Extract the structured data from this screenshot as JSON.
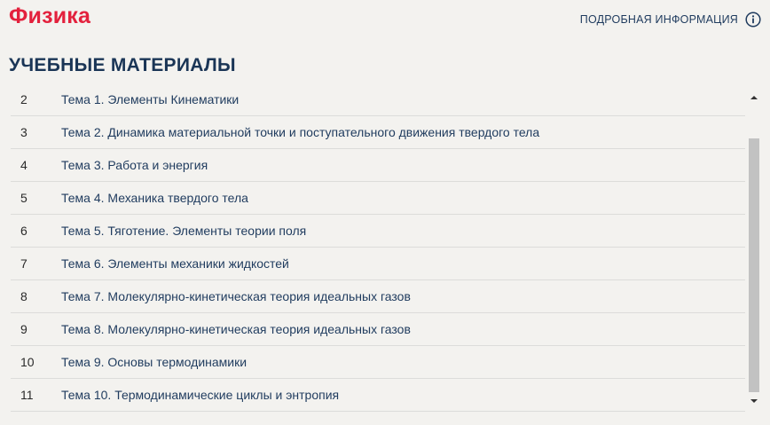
{
  "header": {
    "app_title": "Физика",
    "info_label": "ПОДРОБНАЯ ИНФОРМАЦИЯ",
    "info_icon": "info-circle-icon"
  },
  "section": {
    "title": "УЧЕБНЫЕ МАТЕРИАЛЫ"
  },
  "materials": [
    {
      "num": "2",
      "title": "Тема 1. Элементы Кинематики"
    },
    {
      "num": "3",
      "title": "Тема 2. Динамика материальной точки и поступательного движения твердого тела"
    },
    {
      "num": "4",
      "title": "Тема 3. Работа и энергия"
    },
    {
      "num": "5",
      "title": "Тема 4. Механика твердого тела"
    },
    {
      "num": "6",
      "title": "Тема 5. Тяготение. Элементы теории поля"
    },
    {
      "num": "7",
      "title": "Тема 6. Элементы механики жидкостей"
    },
    {
      "num": "8",
      "title": "Тема 7. Молекулярно-кинетическая теория идеальных газов"
    },
    {
      "num": "9",
      "title": "Тема 8. Молекулярно-кинетическая теория идеальных газов"
    },
    {
      "num": "10",
      "title": "Тема 9. Основы термодинамики"
    },
    {
      "num": "11",
      "title": "Тема 10. Термодинамические циклы и энтропия"
    }
  ],
  "colors": {
    "brand_red": "#e3213d",
    "link_blue": "#1f3b5e",
    "background": "#f3f2ef"
  }
}
